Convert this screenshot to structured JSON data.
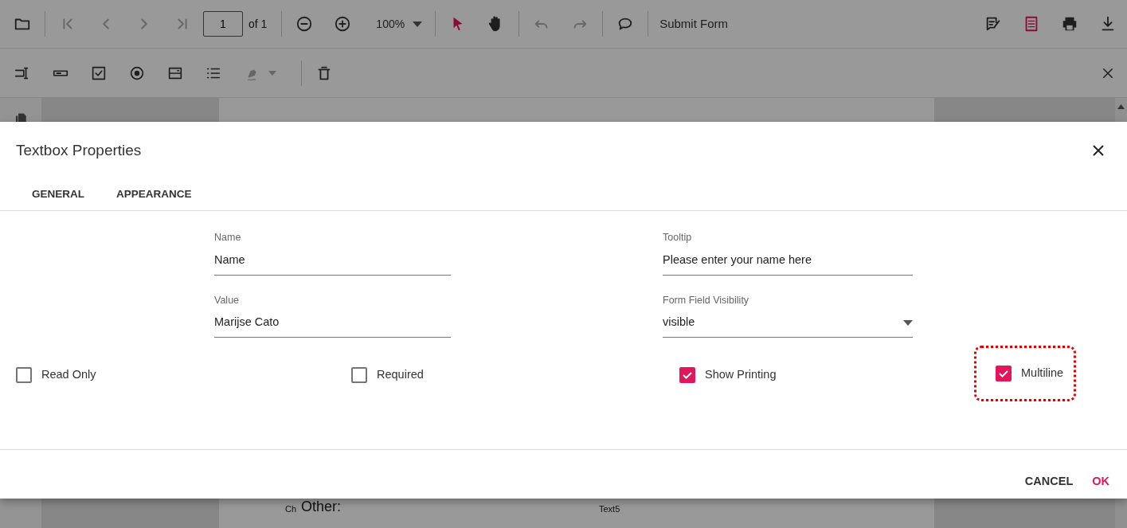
{
  "toolbar": {
    "tools": [
      {
        "kind": "open",
        "disabled": false,
        "selected": false
      },
      {
        "kind": "divider"
      },
      {
        "kind": "first",
        "disabled": true,
        "selected": false
      },
      {
        "kind": "prev",
        "disabled": true,
        "selected": false
      },
      {
        "kind": "next",
        "disabled": true,
        "selected": false
      },
      {
        "kind": "last",
        "disabled": true,
        "selected": false
      },
      {
        "kind": "page",
        "value": "1",
        "count": "of 1"
      },
      {
        "kind": "divider"
      },
      {
        "kind": "zoomout",
        "disabled": false,
        "selected": false
      },
      {
        "kind": "zoomin",
        "disabled": false,
        "selected": false
      },
      {
        "kind": "zoom",
        "value": "100%"
      },
      {
        "kind": "divider"
      },
      {
        "kind": "select",
        "disabled": false,
        "selected": true
      },
      {
        "kind": "pan",
        "disabled": false,
        "selected": false
      },
      {
        "kind": "divider"
      },
      {
        "kind": "undo",
        "disabled": true,
        "selected": false
      },
      {
        "kind": "redo",
        "disabled": true,
        "selected": false
      },
      {
        "kind": "divider"
      },
      {
        "kind": "comment",
        "disabled": false,
        "selected": false
      },
      {
        "kind": "divider"
      },
      {
        "kind": "text",
        "label": "Submit Form"
      }
    ],
    "right_tools": [
      {
        "kind": "editform",
        "disabled": false,
        "selected": false
      },
      {
        "kind": "annotate",
        "disabled": false,
        "selected": true
      },
      {
        "kind": "print",
        "disabled": false,
        "selected": false
      },
      {
        "kind": "download",
        "disabled": false,
        "selected": false
      }
    ]
  },
  "form_toolbar": {
    "tools": [
      {
        "kind": "textbox",
        "disabled": false
      },
      {
        "kind": "password",
        "disabled": false
      },
      {
        "kind": "checkbox",
        "disabled": false
      },
      {
        "kind": "radio",
        "disabled": false
      },
      {
        "kind": "dropdown",
        "disabled": false
      },
      {
        "kind": "listbox",
        "disabled": false
      },
      {
        "kind": "signature",
        "disabled": true
      },
      {
        "kind": "divider"
      },
      {
        "kind": "delete",
        "disabled": false
      }
    ]
  },
  "document": {
    "texts": [
      {
        "kind": "small",
        "text": "Ch"
      },
      {
        "kind": "large",
        "text": "Other:"
      },
      {
        "kind": "field",
        "text": "Text5"
      }
    ]
  },
  "dialog": {
    "title": "Textbox Properties",
    "tabs": [
      {
        "label": "GENERAL",
        "selected": false
      },
      {
        "label": "APPEARANCE",
        "selected": false
      }
    ],
    "fields": [
      {
        "label": "Name",
        "value": "Name",
        "kind": "text"
      },
      {
        "label": "Tooltip",
        "value": "Please enter your name here",
        "kind": "text"
      },
      {
        "label": "Value",
        "value": "Marijse Cato",
        "kind": "text"
      },
      {
        "label": "Form Field Visibility",
        "value": "visible",
        "kind": "dropdown"
      }
    ],
    "options": [
      {
        "label": "Read Only",
        "checked": false,
        "highlighted": false
      },
      {
        "label": "Required",
        "checked": false,
        "highlighted": false
      },
      {
        "label": "Show Printing",
        "checked": true,
        "highlighted": false
      },
      {
        "label": "Multiline",
        "checked": true,
        "highlighted": true
      }
    ],
    "buttons": [
      {
        "label": "CANCEL",
        "kind": "secondary"
      },
      {
        "label": "OK",
        "kind": "primary"
      }
    ]
  }
}
